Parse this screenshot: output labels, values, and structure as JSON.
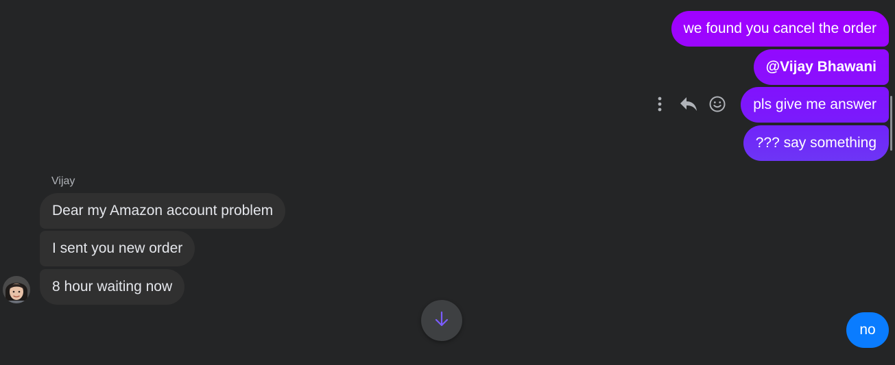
{
  "colors": {
    "background": "#242526",
    "outgoing_gradient_top": "#a000ff",
    "outgoing_gradient_bottom": "#6d35f5",
    "incoming": "#303030",
    "latest_outgoing": "#0a7cff",
    "scroll_arrow": "#7b5cff"
  },
  "outgoing": [
    {
      "text": "we found you cancel the order"
    },
    {
      "text": "@Vijay Bhawani"
    },
    {
      "text": "pls give me answer"
    },
    {
      "text": "??? say something"
    }
  ],
  "incoming": {
    "sender": "Vijay",
    "messages": [
      {
        "text": "Dear my Amazon account problem"
      },
      {
        "text": "I sent you new order"
      },
      {
        "text": "8 hour waiting now"
      }
    ]
  },
  "latest_outgoing": {
    "text": "no"
  },
  "actions": {
    "more_icon": "more-vertical-icon",
    "reply_icon": "reply-icon",
    "react_icon": "smiley-icon"
  },
  "scroll_button": {
    "icon": "arrow-down-icon"
  }
}
